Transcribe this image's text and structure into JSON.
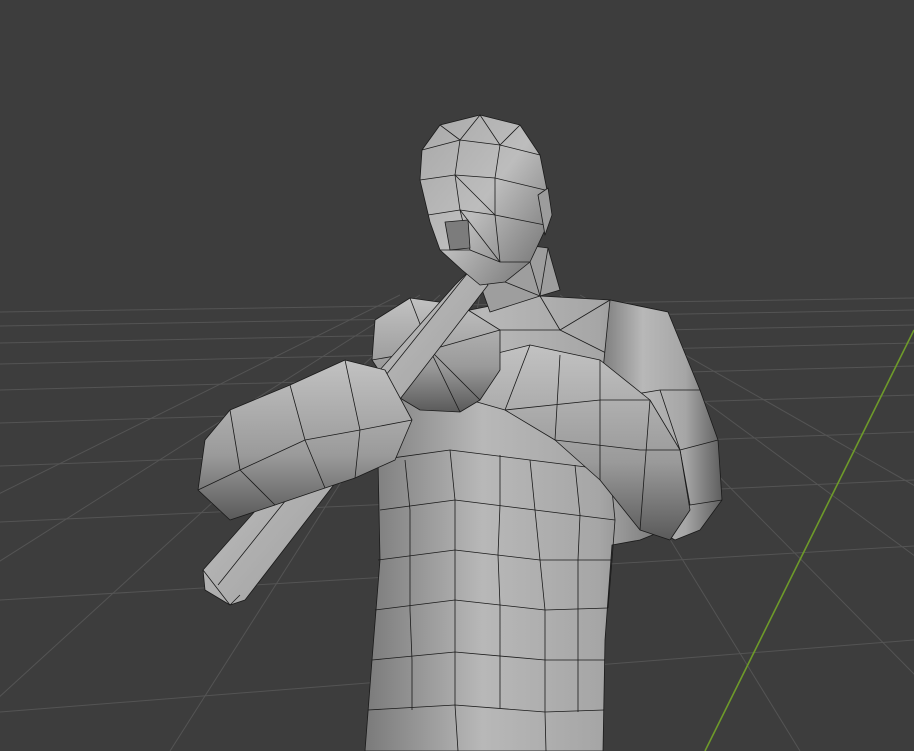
{
  "viewport": {
    "mode": "solid-wireframe",
    "object": "low-poly-character-with-hammer",
    "grid_visible": true,
    "axes_visible": [
      "y-axis"
    ]
  },
  "colors": {
    "background": "#3d3d3d",
    "grid_line": "#545454",
    "y_axis": "#6e9a2a",
    "mesh_light": "#b5b5b5",
    "mesh_mid": "#8a8a8a",
    "mesh_dark": "#5a5a5a",
    "wire": "#1a1a1a"
  }
}
